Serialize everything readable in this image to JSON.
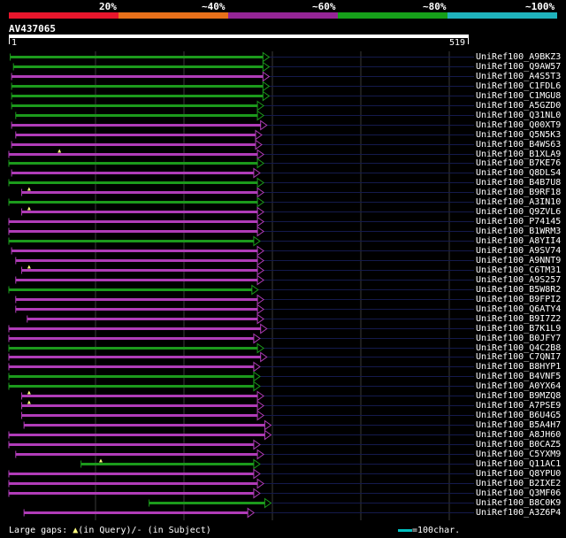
{
  "legend": {
    "labels": [
      "20%",
      "~40%",
      "~60%",
      "~80%",
      "~100%"
    ],
    "colors": [
      "#e8162c",
      "#e8701a",
      "#952596",
      "#16a01a",
      "#1fb3bd"
    ]
  },
  "query": {
    "name": "AV437065",
    "start": "1",
    "end": "519"
  },
  "colors": {
    "purple": "#b03cb8",
    "green": "#1c9a1c",
    "background_line": "#141a4c",
    "gridline": "#3a3a3a",
    "gap_marker": "#ffff80"
  },
  "hits": [
    {
      "name": "UniRef100_A9BKZ3",
      "start": 3,
      "end": 566,
      "color": "green"
    },
    {
      "name": "UniRef100_Q9AW57",
      "start": 10,
      "end": 566,
      "color": "green"
    },
    {
      "name": "UniRef100_A4S5T3",
      "start": 6,
      "end": 566,
      "color": "purple"
    },
    {
      "name": "UniRef100_C1FDL6",
      "start": 6,
      "end": 566,
      "color": "green"
    },
    {
      "name": "UniRef100_C1MGU8",
      "start": 6,
      "end": 566,
      "color": "green"
    },
    {
      "name": "UniRef100_A5GZD0",
      "start": 6,
      "end": 554,
      "color": "green"
    },
    {
      "name": "UniRef100_Q31NL0",
      "start": 15,
      "end": 554,
      "color": "green"
    },
    {
      "name": "UniRef100_Q00XT9",
      "start": 6,
      "end": 561,
      "color": "purple"
    },
    {
      "name": "UniRef100_Q5N5K3",
      "start": 15,
      "end": 550,
      "color": "purple"
    },
    {
      "name": "UniRef100_B4WS63",
      "start": 6,
      "end": 550,
      "color": "purple"
    },
    {
      "name": "UniRef100_B1XLA9",
      "start": 0,
      "end": 554,
      "color": "purple",
      "gap": 110
    },
    {
      "name": "UniRef100_B7KE76",
      "start": 0,
      "end": 554,
      "color": "green"
    },
    {
      "name": "UniRef100_Q8DLS4",
      "start": 6,
      "end": 546,
      "color": "purple"
    },
    {
      "name": "UniRef100_B4B7U8",
      "start": 0,
      "end": 554,
      "color": "green"
    },
    {
      "name": "UniRef100_B9RF18",
      "start": 28,
      "end": 554,
      "color": "purple",
      "gap": 44
    },
    {
      "name": "UniRef100_A3IN10",
      "start": 0,
      "end": 554,
      "color": "green"
    },
    {
      "name": "UniRef100_Q9ZVL6",
      "start": 28,
      "end": 554,
      "color": "purple",
      "gap": 44
    },
    {
      "name": "UniRef100_P74145",
      "start": 0,
      "end": 554,
      "color": "purple"
    },
    {
      "name": "UniRef100_B1WRM3",
      "start": 0,
      "end": 554,
      "color": "purple"
    },
    {
      "name": "UniRef100_A8YII4",
      "start": 0,
      "end": 546,
      "color": "green"
    },
    {
      "name": "UniRef100_A9SV74",
      "start": 6,
      "end": 554,
      "color": "purple"
    },
    {
      "name": "UniRef100_A9NNT9",
      "start": 15,
      "end": 554,
      "color": "purple"
    },
    {
      "name": "UniRef100_C6TM31",
      "start": 28,
      "end": 554,
      "color": "purple",
      "gap": 44
    },
    {
      "name": "UniRef100_A9S257",
      "start": 15,
      "end": 554,
      "color": "purple"
    },
    {
      "name": "UniRef100_B5W8R2",
      "start": 0,
      "end": 542,
      "color": "green"
    },
    {
      "name": "UniRef100_B9FPI2",
      "start": 15,
      "end": 554,
      "color": "purple"
    },
    {
      "name": "UniRef100_Q6ATY4",
      "start": 15,
      "end": 554,
      "color": "purple"
    },
    {
      "name": "UniRef100_B9I7Z2",
      "start": 40,
      "end": 554,
      "color": "purple"
    },
    {
      "name": "UniRef100_B7K1L9",
      "start": 0,
      "end": 561,
      "color": "purple"
    },
    {
      "name": "UniRef100_B0JFY7",
      "start": 0,
      "end": 546,
      "color": "purple"
    },
    {
      "name": "UniRef100_Q4C2B8",
      "start": 0,
      "end": 554,
      "color": "green"
    },
    {
      "name": "UniRef100_C7QNI7",
      "start": 0,
      "end": 561,
      "color": "purple"
    },
    {
      "name": "UniRef100_B8HYP1",
      "start": 0,
      "end": 546,
      "color": "purple"
    },
    {
      "name": "UniRef100_B4VNF5",
      "start": 0,
      "end": 546,
      "color": "green"
    },
    {
      "name": "UniRef100_A0YX64",
      "start": 0,
      "end": 546,
      "color": "green"
    },
    {
      "name": "UniRef100_B9MZQ8",
      "start": 28,
      "end": 554,
      "color": "purple",
      "gap": 44
    },
    {
      "name": "UniRef100_A7PSE9",
      "start": 28,
      "end": 554,
      "color": "purple",
      "gap": 44
    },
    {
      "name": "UniRef100_B6U4G5",
      "start": 28,
      "end": 554,
      "color": "purple"
    },
    {
      "name": "UniRef100_B5A4H7",
      "start": 33,
      "end": 570,
      "color": "purple"
    },
    {
      "name": "UniRef100_A8JH60",
      "start": 0,
      "end": 570,
      "color": "purple"
    },
    {
      "name": "UniRef100_B0CAZ5",
      "start": 0,
      "end": 546,
      "color": "purple"
    },
    {
      "name": "UniRef100_C5YXM9",
      "start": 15,
      "end": 554,
      "color": "purple"
    },
    {
      "name": "UniRef100_Q11AC1",
      "start": 157,
      "end": 546,
      "color": "green",
      "gap": 200
    },
    {
      "name": "UniRef100_Q8YPU0",
      "start": 0,
      "end": 546,
      "color": "purple"
    },
    {
      "name": "UniRef100_B2IXE2",
      "start": 0,
      "end": 554,
      "color": "purple"
    },
    {
      "name": "UniRef100_Q3MF06",
      "start": 0,
      "end": 546,
      "color": "purple"
    },
    {
      "name": "UniRef100_B8C0K9",
      "start": 305,
      "end": 570,
      "color": "green"
    },
    {
      "name": "UniRef100_A3Z6P4",
      "start": 33,
      "end": 533,
      "color": "purple"
    }
  ],
  "footer": {
    "label": "Large gaps: ",
    "tri": "▲",
    "query_text": "(in Query)/",
    "dash": "-",
    "subject_text": " (in Subject)",
    "scale_label": "=100char."
  }
}
